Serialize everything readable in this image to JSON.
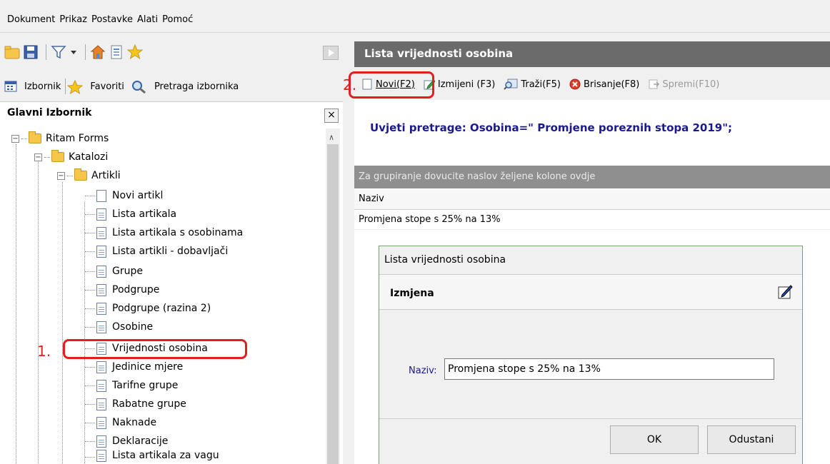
{
  "menubar": [
    "Dokument",
    "Prikaz",
    "Postavke",
    "Alati",
    "Pomoć"
  ],
  "tabs": {
    "izbornik": "Izbornik",
    "favoriti": "Favoriti",
    "pretraga": "Pretraga izbornika"
  },
  "left_panel": {
    "title": "Glavni Izbornik",
    "close": "×"
  },
  "tree": {
    "root": "Ritam Forms",
    "katalozi": "Katalozi",
    "artikli": "Artikli",
    "items": [
      "Novi artikl",
      "Lista artikala",
      "Lista artikala s osobinama",
      "Lista artikli - dobavljači",
      "Grupe",
      "Podgrupe",
      "Podgrupe (razina 2)",
      "Osobine",
      "Vrijednosti osobina",
      "Jedinice mjere",
      "Tarifne grupe",
      "Rabatne grupe",
      "Naknade",
      "Deklaracije",
      "Lista artikala za vagu"
    ]
  },
  "annotations": {
    "step1": "1.",
    "step2": "2."
  },
  "right_panel": {
    "title": "Lista vrijednosti osobina",
    "toolbar": {
      "novi": "Novi(F2)",
      "izmijeni": "Izmijeni (F3)",
      "trazi": "Traži(F5)",
      "brisanje": "Brisanje(F8)",
      "spremi": "Spremi(F10)"
    },
    "search_condition": "Uvjeti pretrage: Osobina=\" Promjene poreznih stopa 2019\";",
    "group_bar": "Za grupiranje dovucite naslov željene kolone ovdje",
    "column": "Naziv",
    "row": "Promjena stope s 25% na 13%"
  },
  "dialog": {
    "title": "Lista vrijednosti osobina",
    "header": "Izmjena",
    "field_label": "Naziv:",
    "field_value": "Promjena stope s 25% na 13%",
    "ok": "OK",
    "cancel": "Odustani"
  }
}
